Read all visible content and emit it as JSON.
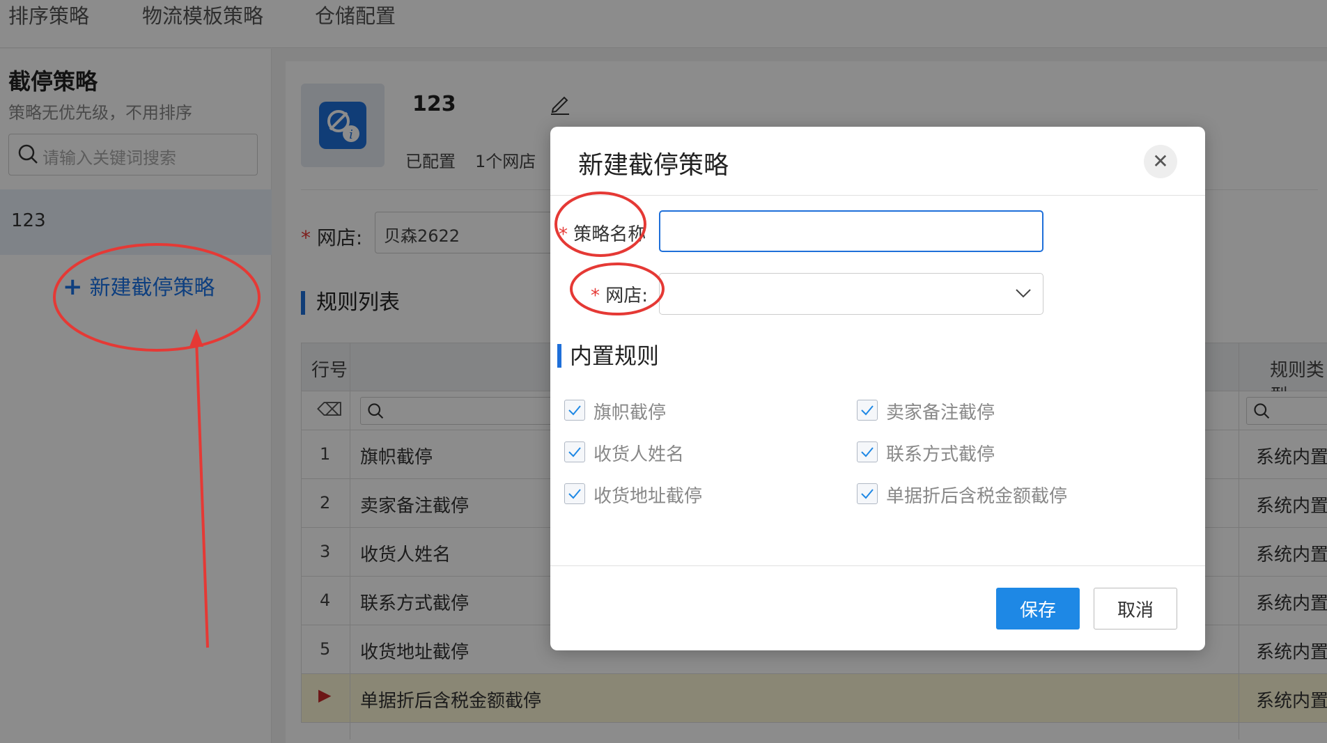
{
  "topnav": {
    "tabs": [
      "排序策略",
      "物流模板策略",
      "仓储配置"
    ]
  },
  "sidebar": {
    "title": "截停策略",
    "subtitle": "策略无优先级，不用排序",
    "search_placeholder": "请输入关键词搜索",
    "items": [
      {
        "label": "123"
      }
    ],
    "new_label": "新建截停策略"
  },
  "main": {
    "strategy_name": "123",
    "meta_configured": "已配置",
    "meta_shops": "1个网店",
    "shop_label": "网店:",
    "shop_value": "贝森2622",
    "rules_title": "规则列表",
    "table": {
      "headers": [
        "行号",
        "规则类型"
      ],
      "rows": [
        {
          "idx": "1",
          "name": "旗帜截停",
          "type": "系统内置"
        },
        {
          "idx": "2",
          "name": "卖家备注截停",
          "type": "系统内置"
        },
        {
          "idx": "3",
          "name": "收货人姓名",
          "type": "系统内置"
        },
        {
          "idx": "4",
          "name": "联系方式截停",
          "type": "系统内置"
        },
        {
          "idx": "5",
          "name": "收货地址截停",
          "type": "系统内置"
        },
        {
          "idx": "▶",
          "name": "单据折后含税金额截停",
          "type": "系统内置"
        }
      ]
    }
  },
  "modal": {
    "title": "新建截停策略",
    "close_icon": "close-icon",
    "name_label": "策略名称",
    "name_value": "",
    "shop_label": "网店:",
    "shop_value": "",
    "builtin_title": "内置规则",
    "rules": [
      {
        "label": "旗帜截停",
        "checked": true
      },
      {
        "label": "卖家备注截停",
        "checked": true
      },
      {
        "label": "收货人姓名",
        "checked": true
      },
      {
        "label": "联系方式截停",
        "checked": true
      },
      {
        "label": "收货地址截停",
        "checked": true
      },
      {
        "label": "单据折后含税金额截停",
        "checked": true
      }
    ],
    "save_label": "保存",
    "cancel_label": "取消"
  },
  "colors": {
    "accent": "#1e88e5",
    "annotation": "#e53935"
  }
}
